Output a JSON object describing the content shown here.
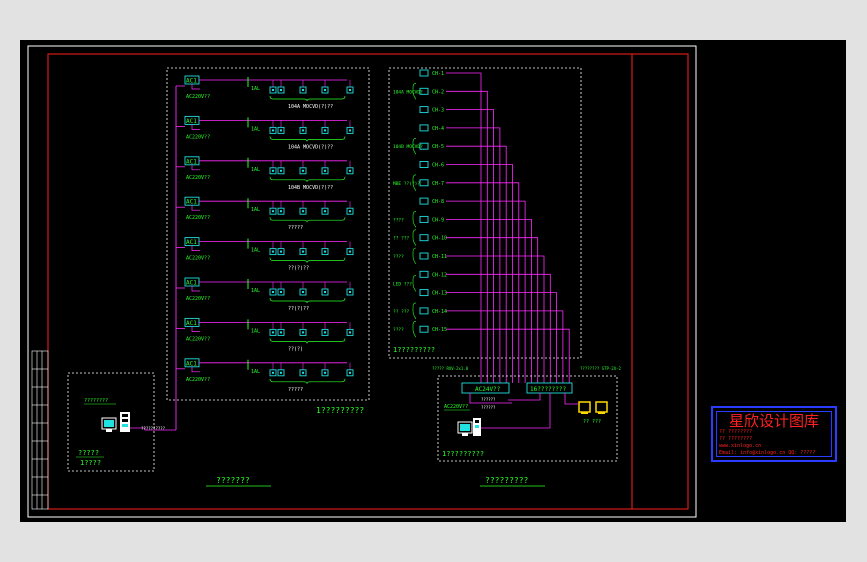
{
  "colors": {
    "background": "#e2e2e2",
    "model_space": "#000000",
    "frame": "#ff2020",
    "border": "#ffffff",
    "wire": "#ff2bff",
    "device": "#20e0e0",
    "text": "#29ff29",
    "boundary": "#ffffff",
    "stamp_border": "#2a3cff",
    "stamp_text": "#ff2020",
    "terminal_fill": "#ffd800"
  },
  "left_panel": {
    "rows": [
      {
        "controller": "AC1",
        "controller_label": "AC220V??",
        "branch": "1AL",
        "caption": "104A MOCVD(?)??"
      },
      {
        "controller": "AC1",
        "controller_label": "AC220V??",
        "branch": "1AL",
        "caption": "104A MOCVD(?)??"
      },
      {
        "controller": "AC1",
        "controller_label": "AC220V??",
        "branch": "1AL",
        "caption": "104B MOCVD(?)??"
      },
      {
        "controller": "AC1",
        "controller_label": "AC220V??",
        "branch": "1AL",
        "caption": "?????"
      },
      {
        "controller": "AC1",
        "controller_label": "AC220V??",
        "branch": "1AL",
        "caption": "??(?)??"
      },
      {
        "controller": "AC1",
        "controller_label": "AC220V??",
        "branch": "1AL",
        "caption": "??(?)??"
      },
      {
        "controller": "AC1",
        "controller_label": "AC220V??",
        "branch": "1AL",
        "caption": "??(?)"
      },
      {
        "controller": "AC1",
        "controller_label": "AC220V??",
        "branch": "1AL",
        "caption": "?????"
      }
    ],
    "footer_caption": "1?????????"
  },
  "right_panel": {
    "channels": [
      "CH-1",
      "CH-2",
      "CH-3",
      "CH-4",
      "CH-5",
      "CH-6",
      "CH-7",
      "CH-8",
      "CH-9",
      "CH-10",
      "CH-11",
      "CH-12",
      "CH-13",
      "CH-14",
      "CH-15"
    ],
    "group_labels": [
      {
        "text": "104A MOCVD?",
        "row": 1
      },
      {
        "text": "104B MOCVD?",
        "row": 4
      },
      {
        "text": "MBE ??(?)?",
        "row": 6
      },
      {
        "text": "????",
        "row": 8
      },
      {
        "text": "?? ???",
        "row": 9
      },
      {
        "text": "????",
        "row": 10
      },
      {
        "text": "LED ???",
        "row": 11.5
      },
      {
        "text": "?? ???",
        "row": 13
      },
      {
        "text": "????",
        "row": 14
      }
    ],
    "footer_caption": "1?????????"
  },
  "station_left": {
    "label_top": "????????",
    "caption_1": "?????",
    "caption_2": "1????",
    "link_label": "??????????"
  },
  "station_right": {
    "cable_label_left": "????? RVV-2x1.0",
    "cable_label_right": "???????? STP-2X-2",
    "ups_box": "AC24V??",
    "switch_box": "16????????",
    "ups_label": "AC220V??",
    "ups_out": "??????",
    "switch_out": "??????",
    "printer_label": "?? ???",
    "footer_caption": "1?????????"
  },
  "bottom_captions": {
    "left": "???????",
    "right": "?????????"
  },
  "stamp": {
    "title": "星欣设计图库",
    "line1": "?? ????????",
    "line2": "?? ????????",
    "line3": "www.xinlogo.cn",
    "line4": "Email: info@xinlogo.cn  QQ: ?????"
  }
}
